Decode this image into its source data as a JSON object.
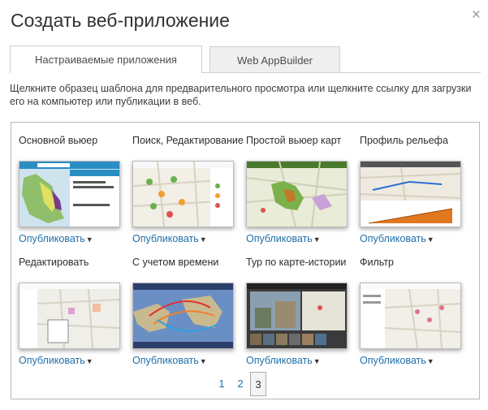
{
  "dialog": {
    "title": "Создать веб-приложение",
    "close": "×"
  },
  "tabs": [
    {
      "label": "Настраиваемые приложения",
      "active": true
    },
    {
      "label": "Web AppBuilder",
      "active": false
    }
  ],
  "intro": "Щелкните образец шаблона для предварительного просмотра или щелкните ссылку для загрузки его на компьютер или публикации в веб.",
  "templates": [
    {
      "name": "Основной вьюер",
      "publish": "Опубликовать",
      "thumb": "basic-viewer"
    },
    {
      "name": "Поиск, Редактирование",
      "publish": "Опубликовать",
      "thumb": "search-edit"
    },
    {
      "name": "Простой вьюер карт",
      "publish": "Опубликовать",
      "thumb": "simple-map-viewer"
    },
    {
      "name": "Профиль рельефа",
      "publish": "Опубликовать",
      "thumb": "elevation-profile"
    },
    {
      "name": "Редактировать",
      "publish": "Опубликовать",
      "thumb": "edit"
    },
    {
      "name": "С учетом времени",
      "publish": "Опубликовать",
      "thumb": "time-aware"
    },
    {
      "name": "Тур по карте-истории",
      "publish": "Опубликовать",
      "thumb": "story-map-tour"
    },
    {
      "name": "Фильтр",
      "publish": "Опубликовать",
      "thumb": "filter"
    }
  ],
  "pagination": {
    "pages": [
      "1",
      "2",
      "3"
    ],
    "current": "3"
  },
  "colors": {
    "link": "#1f6fa8",
    "border": "#b9b9b9"
  }
}
